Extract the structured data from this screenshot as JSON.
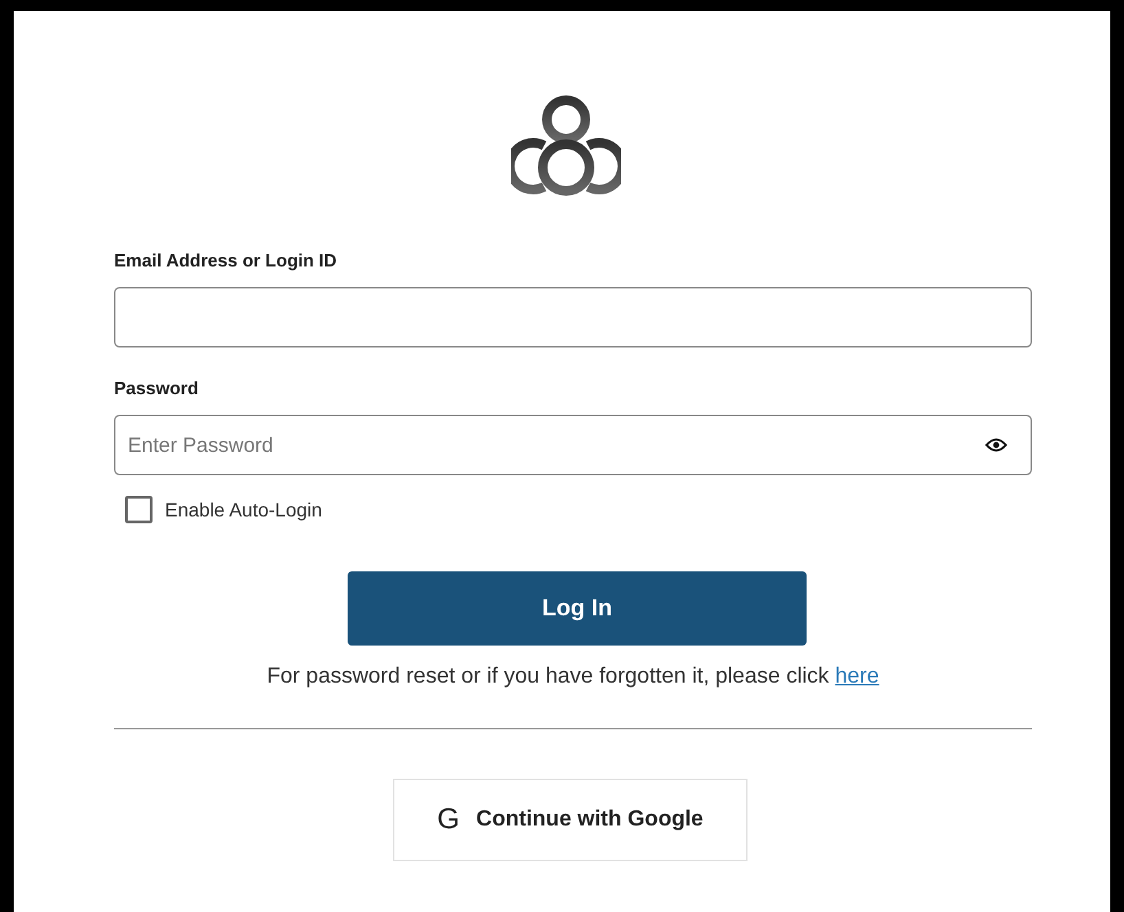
{
  "form": {
    "email": {
      "label": "Email Address or Login ID"
    },
    "password": {
      "label": "Password",
      "placeholder": "Enter Password"
    },
    "auto_login": {
      "label": "Enable Auto-Login",
      "checked": false
    },
    "login_button": "Log In",
    "reset_text": "For password reset or if you have forgotten it, please click ",
    "reset_link": "here",
    "google_button": {
      "icon": "G",
      "label": "Continue with Google"
    }
  }
}
